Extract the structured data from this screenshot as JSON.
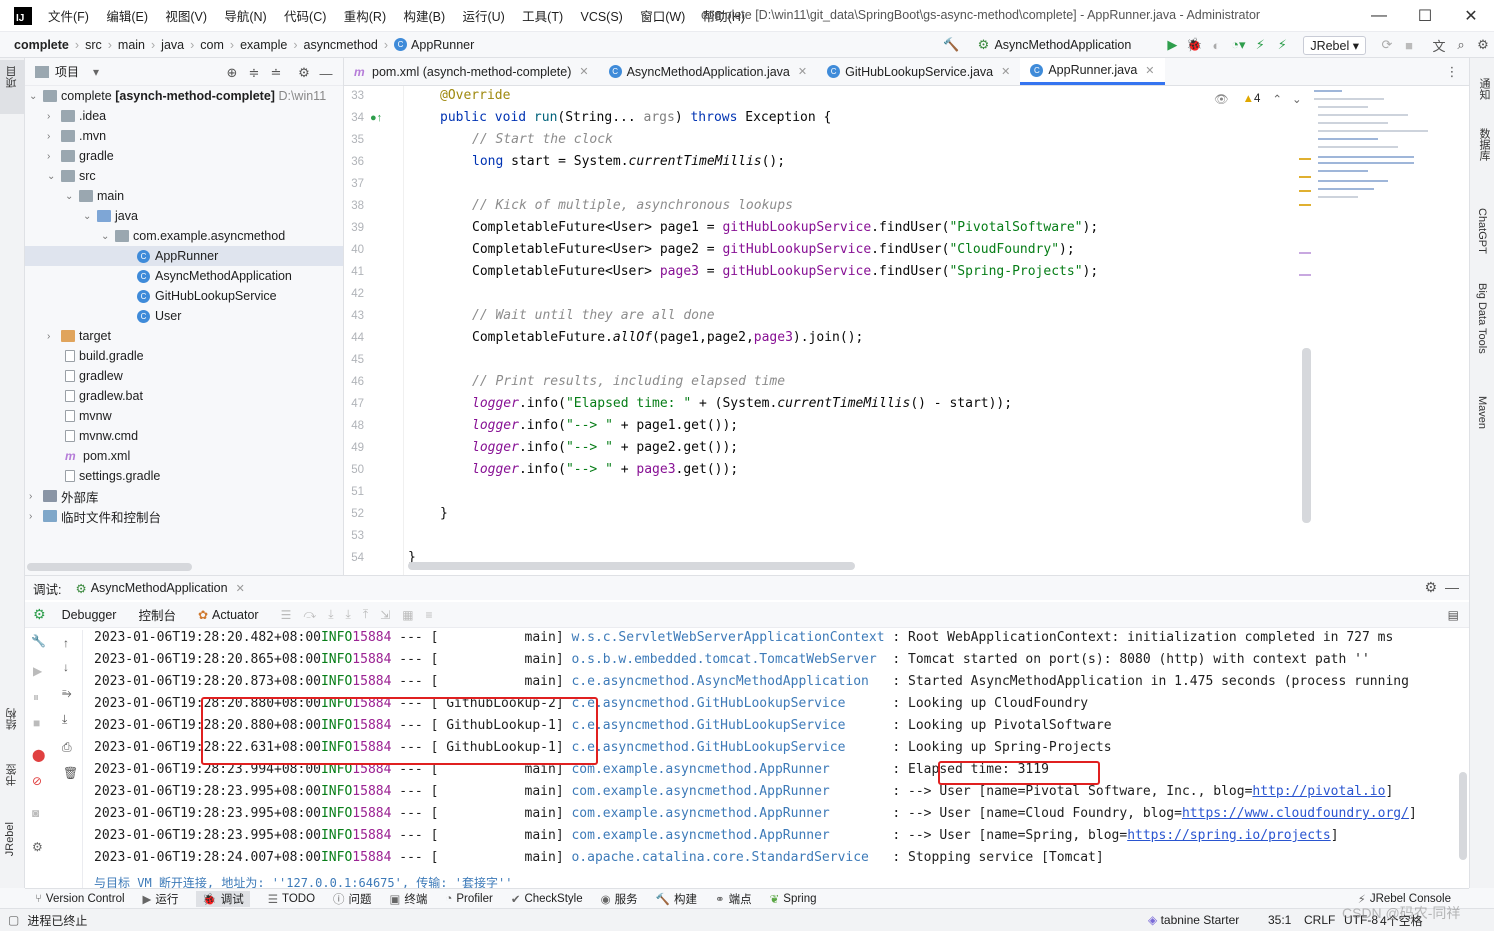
{
  "titlebar": {
    "logo": "IJ",
    "menus": [
      "文件(F)",
      "编辑(E)",
      "视图(V)",
      "导航(N)",
      "代码(C)",
      "重构(R)",
      "构建(B)",
      "运行(U)",
      "工具(T)",
      "VCS(S)",
      "窗口(W)",
      "帮助(H)"
    ],
    "title": "complete [D:\\win11\\git_data\\SpringBoot\\gs-async-method\\complete] - AppRunner.java - Administrator"
  },
  "navbar": {
    "crumbs": [
      "complete",
      "src",
      "main",
      "java",
      "com",
      "example",
      "asyncmethod",
      "AppRunner"
    ],
    "run_config": "AsyncMethodApplication",
    "jrebel": "JRebel"
  },
  "left_strip": {
    "project": "项目",
    "structure": "结构",
    "bookmarks": "书签",
    "jrebel": "JRebel"
  },
  "right_strip": {
    "notifications": "通知",
    "database": "数据库",
    "chatgpt": "ChatGPT",
    "bigdata": "Big Data Tools",
    "maven": "Maven"
  },
  "project": {
    "header": "项目",
    "root": "complete",
    "root_module": "[asynch-method-complete]",
    "root_path": "D:\\win11",
    "items": {
      "idea": ".idea",
      "mvn": ".mvn",
      "gradle": "gradle",
      "src": "src",
      "main": "main",
      "java": "java",
      "pkg": "com.example.asyncmethod",
      "c1": "AppRunner",
      "c2": "AsyncMethodApplication",
      "c3": "GitHubLookupService",
      "c4": "User",
      "target": "target",
      "build_gradle": "build.gradle",
      "gradlew": "gradlew",
      "gradlew_bat": "gradlew.bat",
      "mvnw": "mvnw",
      "mvnw_cmd": "mvnw.cmd",
      "pom": "pom.xml",
      "settings": "settings.gradle",
      "ext_libs": "外部库",
      "scratches": "临时文件和控制台"
    }
  },
  "tabs": [
    {
      "label": "pom.xml (asynch-method-complete)"
    },
    {
      "label": "AsyncMethodApplication.java"
    },
    {
      "label": "GitHubLookupService.java"
    },
    {
      "label": "AppRunner.java"
    }
  ],
  "editor": {
    "warnings": "4",
    "line_numbers": [
      "33",
      "34",
      "35",
      "36",
      "37",
      "38",
      "39",
      "40",
      "41",
      "42",
      "43",
      "44",
      "45",
      "46",
      "47",
      "48",
      "49",
      "50",
      "51",
      "52",
      "53",
      "54"
    ]
  },
  "debug": {
    "title": "调试:",
    "config": "AsyncMethodApplication",
    "tabs": {
      "debugger": "Debugger",
      "console": "控制台",
      "actuator": "Actuator"
    },
    "lines": [
      {
        "ts": "2023-01-06T19:28:20.482+08:00",
        "lvl": "INFO",
        "pid": "15884",
        "thread": "main",
        "logger": "w.s.c.ServletWebServerApplicationContext",
        "msg": "Root WebApplicationContext: initialization completed in 727 ms"
      },
      {
        "ts": "2023-01-06T19:28:20.865+08:00",
        "lvl": "INFO",
        "pid": "15884",
        "thread": "main",
        "logger": "o.s.b.w.embedded.tomcat.TomcatWebServer",
        "msg": "Tomcat started on port(s): 8080 (http) with context path ''"
      },
      {
        "ts": "2023-01-06T19:28:20.873+08:00",
        "lvl": "INFO",
        "pid": "15884",
        "thread": "main",
        "logger": "c.e.asyncmethod.AsyncMethodApplication",
        "msg": "Started AsyncMethodApplication in 1.475 seconds (process running"
      },
      {
        "ts_a": "2023-01-06T19",
        "ts_b": "28:20.880+08:00",
        "lvl": "INFO",
        "pid": "15884",
        "thread": "GithubLookup-2",
        "logger": "c.e.asyncmethod.GitHubLookupService",
        "msg": "Looking up CloudFoundry"
      },
      {
        "ts_a": "2023-01-06T19",
        "ts_b": "28:20.880+08:00",
        "lvl": "INFO",
        "pid": "15884",
        "thread": "GithubLookup-1",
        "logger": "c.e.asyncmethod.GitHubLookupService",
        "msg": "Looking up PivotalSoftware"
      },
      {
        "ts_a": "2023-01-06T19",
        "ts_b": "28:22.631+08:00",
        "lvl": "INFO",
        "pid": "15884",
        "thread": "GithubLookup-1",
        "logger": "c.e.asyncmethod.GitHubLookupService",
        "msg": "Looking up Spring-Projects"
      },
      {
        "ts": "2023-01-06T19:28:23.994+08:00",
        "lvl": "INFO",
        "pid": "15884",
        "thread": "main",
        "logger": "com.example.asyncmethod.AppRunner",
        "msg": "Elapsed time: 3119"
      },
      {
        "ts": "2023-01-06T19:28:23.995+08:00",
        "lvl": "INFO",
        "pid": "15884",
        "thread": "main",
        "logger": "com.example.asyncmethod.AppRunner",
        "msg": "--> User [name=Pivotal Software, Inc., blog=",
        "link": "http://pivotal.io",
        "tail": "]"
      },
      {
        "ts": "2023-01-06T19:28:23.995+08:00",
        "lvl": "INFO",
        "pid": "15884",
        "thread": "main",
        "logger": "com.example.asyncmethod.AppRunner",
        "msg": "--> User [name=Cloud Foundry, blog=",
        "link": "https://www.cloudfoundry.org/",
        "tail": "]"
      },
      {
        "ts": "2023-01-06T19:28:23.995+08:00",
        "lvl": "INFO",
        "pid": "15884",
        "thread": "main",
        "logger": "com.example.asyncmethod.AppRunner",
        "msg": "--> User [name=Spring, blog=",
        "link": "https://spring.io/projects",
        "tail": "]"
      },
      {
        "ts": "2023-01-06T19:28:24.007+08:00",
        "lvl": "INFO",
        "pid": "15884",
        "thread": "main",
        "logger": "o.apache.catalina.core.StandardService",
        "msg": "Stopping service [Tomcat]"
      }
    ],
    "partial_line": "与目标 VM 断开连接, 地址为: ''127.0.0.1:64675', 传输: '套接字''"
  },
  "bottombar": [
    "Version Control",
    "运行",
    "调试",
    "TODO",
    "问题",
    "终端",
    "Profiler",
    "CheckStyle",
    "服务",
    "构建",
    "端点",
    "Spring"
  ],
  "bottombar_right": "JRebel Console",
  "status": {
    "left": "进程已终止",
    "tabnine": "tabnine Starter",
    "pos": "35:1",
    "crlf": "CRLF",
    "enc": "UTF-8",
    "indent": "4个空格",
    "watermark": "CSDN @码农-同祥"
  }
}
